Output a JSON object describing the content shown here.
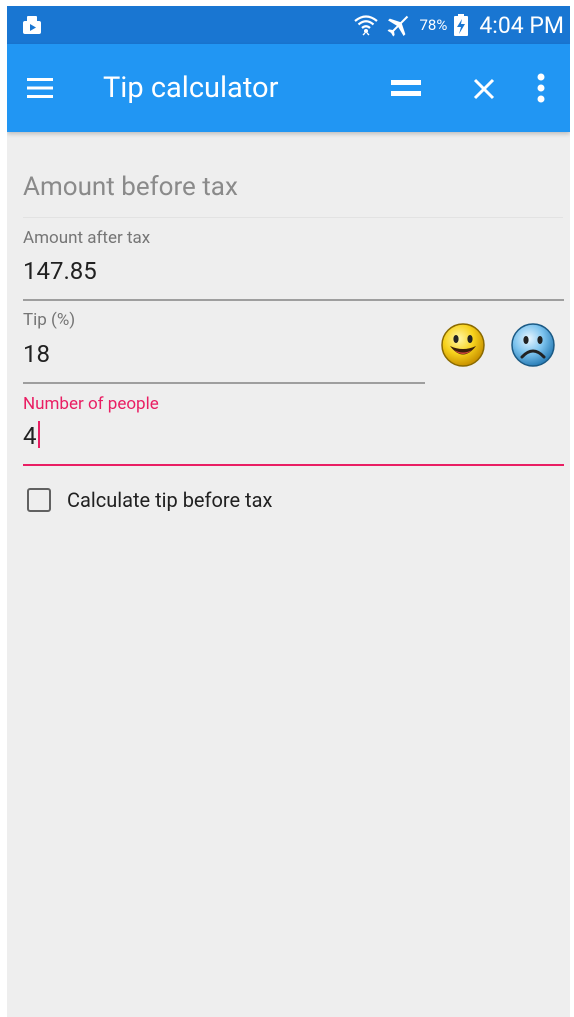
{
  "status_bar": {
    "battery_percent": "78%",
    "time": "4:04 PM",
    "icons": [
      "screenshot-app-icon",
      "wifi-icon",
      "airplane-mode-icon",
      "battery-charging-icon"
    ]
  },
  "app_bar": {
    "title": "Tip calculator",
    "icons": [
      "menu-icon",
      "equals-icon",
      "close-icon",
      "more-vert-icon"
    ]
  },
  "form": {
    "amount_before_tax": {
      "placeholder": "Amount before tax",
      "value": ""
    },
    "amount_after_tax": {
      "label": "Amount after tax",
      "value": "147.85"
    },
    "tip": {
      "label": "Tip (%)",
      "value": "18",
      "buttons": [
        "happy-face-icon",
        "sad-face-icon"
      ]
    },
    "people": {
      "label": "Number of people",
      "value": "4",
      "focused": true
    },
    "tip_before_tax": {
      "label": "Calculate tip before tax",
      "checked": false
    }
  },
  "colors": {
    "status_bar": "#1976d2",
    "app_bar": "#2196f3",
    "accent": "#e91e63",
    "background": "#eeeeee"
  }
}
